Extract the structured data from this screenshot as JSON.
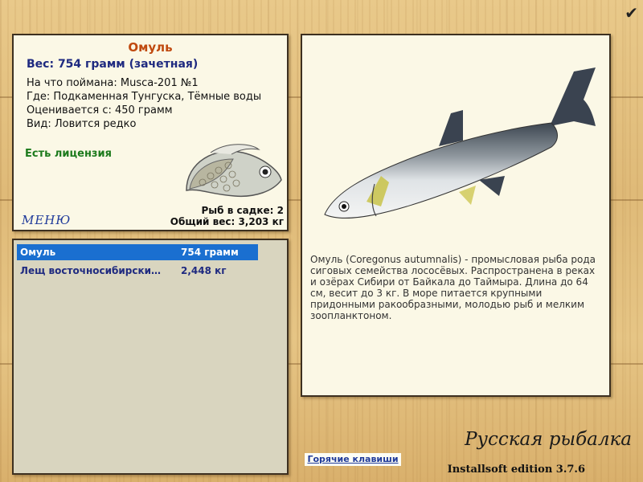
{
  "info": {
    "name": "Омуль",
    "weight_line": "Вес: 754 грамм (зачетная)",
    "caught_on": "На что поймана: Musca-201 №1",
    "where": "Где: Подкаменная Тунгуска, Тёмные воды",
    "rated_from": "Оценивается с: 450 грамм",
    "kind": "Вид: Ловится редко",
    "license": "Есть лицензия",
    "menu": "МЕНЮ",
    "fish_in_keepnet": "Рыб в садке: 2",
    "total_weight": "Общий вес: 3,203 кг"
  },
  "catch_list": [
    {
      "name": "Омуль",
      "weight": "754 грамм",
      "selected": true
    },
    {
      "name": "Лещ восточносибирски…",
      "weight": "2,448 кг",
      "selected": false
    }
  ],
  "description": "Омуль (Coregonus autumnalis) - промысловая рыба рода сиговых семейства лососёвых. Распространена в реках и озёрах Сибири от Байкала до Таймыра. Длина до 64 см, весит до 3 кг. В море питается крупными придонными ракообразными, молодью рыб и мелким зоопланктоном.",
  "footer": {
    "hotkeys": "Горячие клавиши",
    "game_title": "Русская рыбалка",
    "edition": "Installsoft edition 3.7.6"
  },
  "icons": {
    "confirm": "checkmark-icon"
  }
}
